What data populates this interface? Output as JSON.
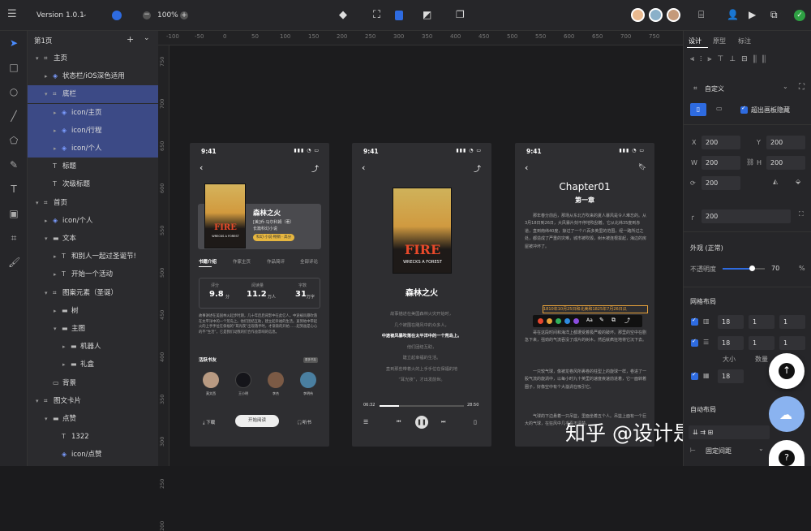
{
  "topbar": {
    "version": "Version 1.0.1",
    "zoom": "100%"
  },
  "layers": {
    "page": "第1页",
    "items": [
      "主页",
      "状态栏/iOS深色适用",
      "底栏",
      "icon/主页",
      "icon/行程",
      "icon/个人",
      "标题",
      "次级标题",
      "首页",
      "icon/个人",
      "文本",
      "和别人一起过圣诞节!",
      "开始一个活动",
      "图案元素（圣诞）",
      "树",
      "主图",
      "机器人",
      "礼盒",
      "背景",
      "图文卡片",
      "点赞",
      "1322",
      "icon/点赞"
    ]
  },
  "ruler": {
    "top": [
      "-100",
      "-50",
      "0",
      "50",
      "100",
      "150",
      "200",
      "250",
      "300",
      "350",
      "400",
      "450",
      "500",
      "550",
      "600",
      "650",
      "700",
      "750"
    ],
    "left": [
      "750",
      "700",
      "650",
      "600",
      "550",
      "500",
      "450",
      "400",
      "350",
      "300",
      "250",
      "200"
    ]
  },
  "phone1": {
    "time": "9:41",
    "book_title": "森林之火",
    "author": "[美]乔·马尔科姆（著）",
    "genre": "长篇科幻小说",
    "tag": "科幻·小说·畅销 · 高分",
    "cover_title": "FIRE",
    "cover_sub": "WRECKS A FOREST",
    "tabs": [
      "书籍介绍",
      "作家主页",
      "作品简评",
      "全部评论"
    ],
    "stats": [
      {
        "label": "评分",
        "value": "9.8",
        "unit": "分"
      },
      {
        "label": "阅读量",
        "value": "11.2",
        "unit": "万人"
      },
      {
        "label": "字数",
        "value": "31",
        "unit": "万字"
      }
    ],
    "desc": "故事讲述在美国林火起步时期，几十年后后背影中在此亿人，中途被风暴吹落在太平洋中的一个荒岛上。他们团结互助，建立起幸福的生活。直到地中带起火的上手手位在保福的“耳光夜”出现落手时，才渐渐的开始……起到画是心心的不“生活”，它是我们动我的们合作会影响的信息。",
    "active_title": "活跃书友",
    "more": "更多书友",
    "friends": [
      "莫文西",
      "王小明",
      "李杰",
      "李明伟"
    ],
    "btn_download": "下载",
    "btn_read": "开始阅读",
    "btn_listen": "听书"
  },
  "phone2": {
    "time": "9:41",
    "title": "森林之火",
    "lyrics": [
      "故事描述在美国森林火灾开始时，",
      "几个被围在飓风中的众多人，",
      "中途被风暴吹落在太平洋中的一个荒岛上。",
      "他们团结互助，",
      "建立起幸福的生活。",
      "直到那些带着火的上手手位在保福的地",
      "“耳光夜”，才出发前世。"
    ],
    "time_start": "06:32",
    "time_end": "28:50"
  },
  "phone3": {
    "time": "9:41",
    "chapter": "Chapter01",
    "chapter_cn": "第一章",
    "p1": "那年春分前后，那场从东北方吹来的夏人暴风是令人难忘的。从3月18日到26日，大风暴片刻不停地吹刮着。它从北纬35度到赤道，直到南纬40度，掠过了一个八百多英里的范围，经一路所过之处，都造成了严重的灾难，城市被吹毁，树木被连根拔起，海边的房屋被冲坏了。",
    "highlight": "1810年10月25日和北美和1825年7月26日瓜",
    "p2": "哥在这段时间和海洋上都遭受着极严峻的破坏。那里的空中在剧急下来，强劲的气流吞没了成片的树木，然后就疯狂地将它沉下去。",
    "p3": "一只较气球，像被龙卷风所裹卷的柱型上的旋球一样，卷进了一股气流的旋涡中，以每小时九十英里的速度疾速前进着，它一面转着圈子，好像空中有个大漩涡在吸引它。",
    "p4": "气球的下边悬着一只吊篮，里面坐着五个人。吊篮上面有一个巨大的气球，在狂风中几乎看不清楚。"
  },
  "inspector": {
    "tabs": [
      "设计",
      "原型",
      "标注"
    ],
    "frame_type": "自定义",
    "clip_label": "超出画板隐藏",
    "x": "200",
    "y": "200",
    "w": "200",
    "h": "200",
    "rotation": "200",
    "radius": "200",
    "appearance": "外观 (正常)",
    "opacity_label": "不透明度",
    "opacity": "70",
    "opacity_unit": "%",
    "grid_title": "网格布局",
    "grid_rows": [
      [
        "18",
        "1",
        "1"
      ],
      [
        "18",
        "1",
        "1"
      ],
      [
        "18"
      ]
    ],
    "size_label": "大小",
    "count_label": "数量",
    "auto_layout": "自动布局",
    "spacing": "固定间距"
  },
  "watermark": "知乎 @设计是门艺术",
  "colors": {
    "accent": "#2e6be0",
    "selected": "#3c4a86",
    "highlight": "#e8a23a"
  }
}
